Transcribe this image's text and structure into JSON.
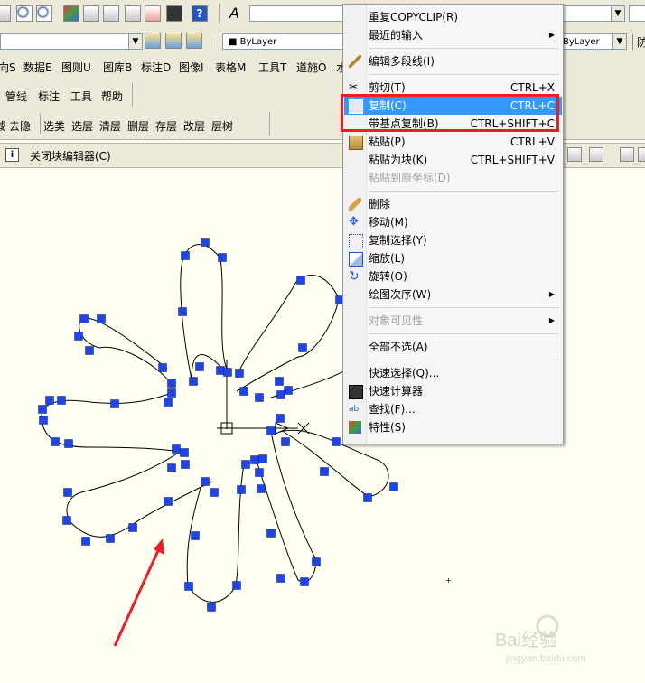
{
  "toolbar": {
    "text_style_glyph": "A",
    "layer_combo": "ByLayer",
    "linetype_combo": "ByLayer",
    "right_label": "防"
  },
  "menu_row": [
    "向S",
    "数据E",
    "图则U",
    "图库B",
    "标注D",
    "图像I",
    "表格M",
    "工具T",
    "道施O",
    "水"
  ],
  "tool_row": [
    "管线",
    "标注",
    "工具",
    "帮助"
  ],
  "layer_row": [
    "去隐",
    "选类",
    "选层",
    "清层",
    "删层",
    "存层",
    "改层",
    "层树"
  ],
  "layer_row_prefix": "减",
  "block_editor": {
    "info_icon": "i",
    "label": "关闭块编辑器(C)"
  },
  "context_menu": {
    "items": [
      {
        "label": "重复COPYCLIP(R)",
        "shortcut": ""
      },
      {
        "label": "最近的输入",
        "shortcut": "",
        "submenu": "▶"
      },
      {
        "label": "编辑多段线(I)",
        "shortcut": ""
      },
      {
        "label": "剪切(T)",
        "shortcut": "CTRL+X"
      },
      {
        "label": "复制(C)",
        "shortcut": "CTRL+C"
      },
      {
        "label": "带基点复制(B)",
        "shortcut": "CTRL+SHIFT+C"
      },
      {
        "label": "粘贴(P)",
        "shortcut": "CTRL+V"
      },
      {
        "label": "粘贴为块(K)",
        "shortcut": "CTRL+SHIFT+V"
      },
      {
        "label": "粘贴到原坐标(D)",
        "shortcut": ""
      },
      {
        "label": "删除",
        "shortcut": ""
      },
      {
        "label": "移动(M)",
        "shortcut": ""
      },
      {
        "label": "复制选择(Y)",
        "shortcut": ""
      },
      {
        "label": "缩放(L)",
        "shortcut": ""
      },
      {
        "label": "旋转(O)",
        "shortcut": ""
      },
      {
        "label": "绘图次序(W)",
        "shortcut": "",
        "submenu": "▶"
      },
      {
        "label": "对象可见性",
        "shortcut": "",
        "submenu": "▶"
      },
      {
        "label": "全部不选(A)",
        "shortcut": ""
      },
      {
        "label": "快速选择(Q)...",
        "shortcut": ""
      },
      {
        "label": "快速计算器",
        "shortcut": ""
      },
      {
        "label": "查找(F)...",
        "shortcut": ""
      },
      {
        "label": "特性(S)",
        "shortcut": ""
      }
    ]
  },
  "watermark": {
    "brand": "Bai经验",
    "url": "jingyan.baidu.com"
  },
  "colors": {
    "highlight": "#3399ff",
    "annotation_red": "#ee1c24",
    "grip_blue": "#1f45e6",
    "canvas_bg": "#fffff2"
  }
}
